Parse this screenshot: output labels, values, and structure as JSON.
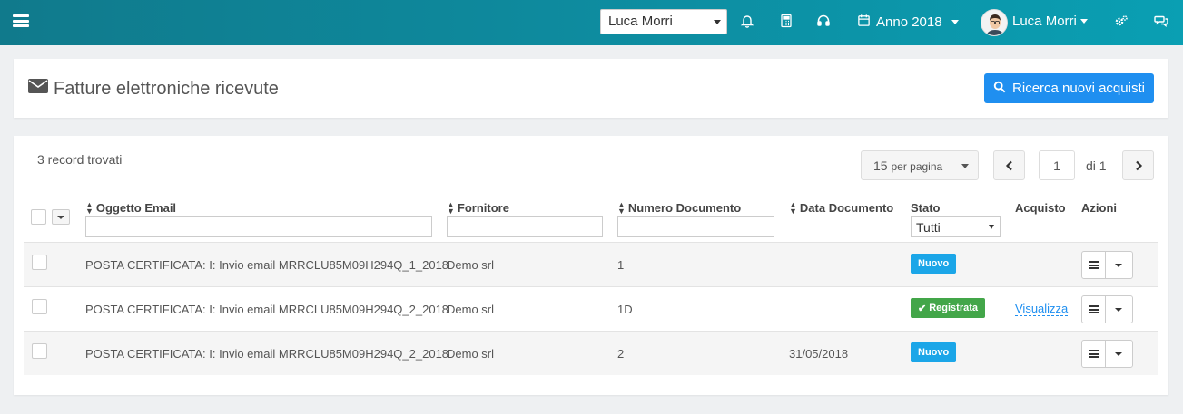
{
  "topbar": {
    "user_select_value": "Luca Morri",
    "year_label": "Anno 2018",
    "username": "Luca Morri",
    "icons": [
      "menu-icon",
      "bell-icon",
      "calculator-icon",
      "headset-icon",
      "calendar-icon",
      "cogs-icon",
      "chat-icon"
    ]
  },
  "header": {
    "title": "Fatture elettroniche ricevute",
    "title_icon": "envelope-icon",
    "search_button": "Ricerca nuovi acquisti"
  },
  "list": {
    "record_count": "3 record trovati",
    "per_page_number": "15",
    "per_page_label": "per pagina",
    "current_page": "1",
    "of_label": "di 1"
  },
  "table": {
    "columns": {
      "subject": "Oggetto Email",
      "supplier": "Fornitore",
      "doc_number": "Numero Documento",
      "doc_date": "Data Documento",
      "status": "Stato",
      "purchase": "Acquisto",
      "actions": "Azioni"
    },
    "status_filter": "Tutti",
    "rows": [
      {
        "subject": "POSTA CERTIFICATA: I: Invio email MRRCLU85M09H294Q_1_2018",
        "supplier": "Demo srl",
        "doc_number": "1",
        "doc_date": "",
        "status": "Nuovo",
        "purchase": ""
      },
      {
        "subject": "POSTA CERTIFICATA: I: Invio email MRRCLU85M09H294Q_2_2018",
        "supplier": "Demo srl",
        "doc_number": "1D",
        "doc_date": "",
        "status": "Registrata",
        "purchase": "Visualizza"
      },
      {
        "subject": "POSTA CERTIFICATA: I: Invio email MRRCLU85M09H294Q_2_2018",
        "supplier": "Demo srl",
        "doc_number": "2",
        "doc_date": "31/05/2018",
        "status": "Nuovo",
        "purchase": ""
      }
    ]
  },
  "colors": {
    "topbar_start": "#107a8c",
    "topbar_end": "#0a9fb3",
    "primary": "#1f8ff0",
    "badge_new": "#1ba6e8",
    "badge_registered": "#43a649"
  }
}
